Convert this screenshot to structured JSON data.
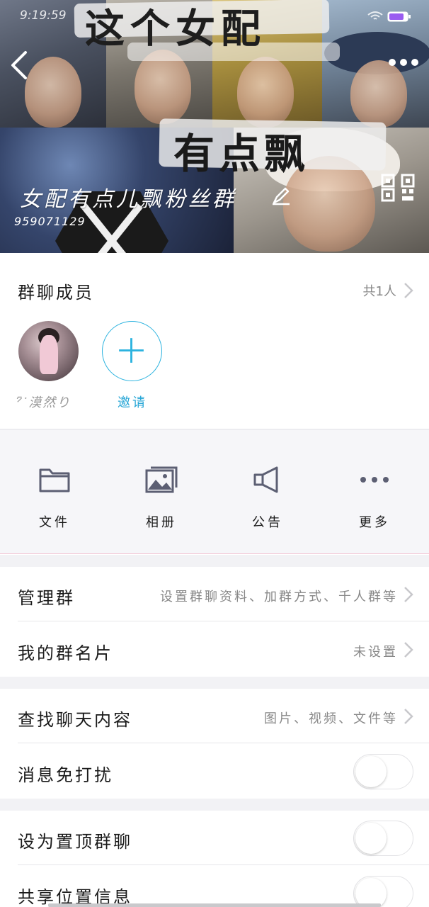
{
  "status_bar": {
    "time": "9:19:59"
  },
  "banner": {
    "title_top": "这个女配",
    "title_bottom": "有点飘",
    "group_name": "女配有点儿飘粉丝群",
    "group_id": "959071129"
  },
  "members": {
    "title": "群聊成员",
    "count": "共1人",
    "list": [
      {
        "name": "ᐟ᷇ᐝ漠然り"
      }
    ],
    "invite_label": "邀请"
  },
  "actions": [
    {
      "label": "文件",
      "icon": "folder-icon"
    },
    {
      "label": "相册",
      "icon": "photo-album-icon"
    },
    {
      "label": "公告",
      "icon": "megaphone-icon"
    },
    {
      "label": "更多",
      "icon": "more-dots-icon"
    }
  ],
  "rows": {
    "manage": {
      "label": "管理群",
      "value": "设置群聊资料、加群方式、千人群等"
    },
    "card": {
      "label": "我的群名片",
      "value": "未设置"
    },
    "search": {
      "label": "查找聊天内容",
      "value": "图片、视频、文件等"
    },
    "mute": {
      "label": "消息免打扰",
      "on": false
    },
    "pin": {
      "label": "设为置顶群聊",
      "on": false
    },
    "location": {
      "label": "共享位置信息",
      "on": false
    }
  },
  "colors": {
    "accent": "#2cb3df",
    "icon": "#5c5f73"
  }
}
